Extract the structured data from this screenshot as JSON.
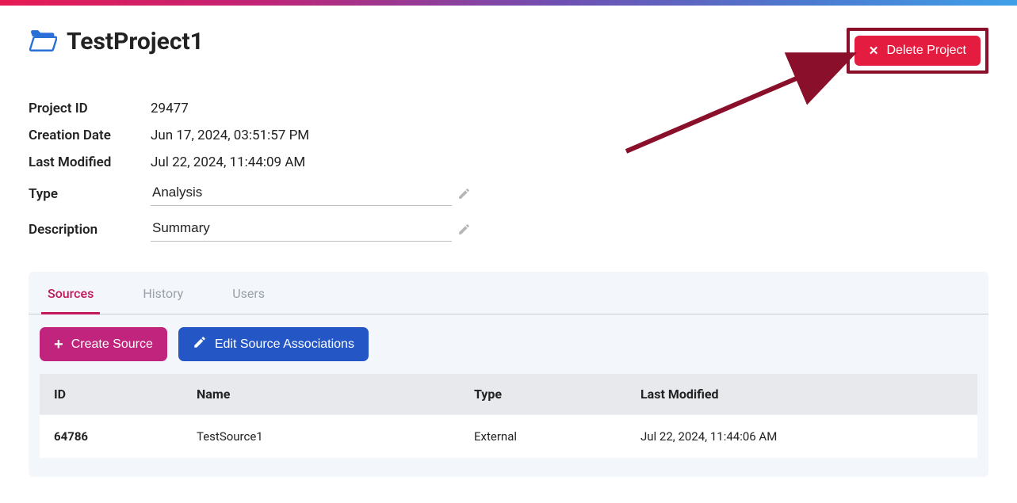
{
  "header": {
    "title": "TestProject1",
    "delete_label": "Delete Project"
  },
  "meta": {
    "project_id_label": "Project ID",
    "project_id": "29477",
    "creation_date_label": "Creation Date",
    "creation_date": "Jun 17, 2024, 03:51:57 PM",
    "last_modified_label": "Last Modified",
    "last_modified": "Jul 22, 2024, 11:44:09 AM",
    "type_label": "Type",
    "type_value": "Analysis",
    "description_label": "Description",
    "description_value": "Summary"
  },
  "tabs": {
    "sources": "Sources",
    "history": "History",
    "users": "Users"
  },
  "toolbar": {
    "create_source": "Create Source",
    "edit_assoc": "Edit Source Associations"
  },
  "table": {
    "headers": {
      "id": "ID",
      "name": "Name",
      "type": "Type",
      "last_modified": "Last Modified"
    },
    "rows": [
      {
        "id": "64786",
        "name": "TestSource1",
        "type": "External",
        "last_modified": "Jul 22, 2024, 11:44:06 AM"
      }
    ]
  }
}
